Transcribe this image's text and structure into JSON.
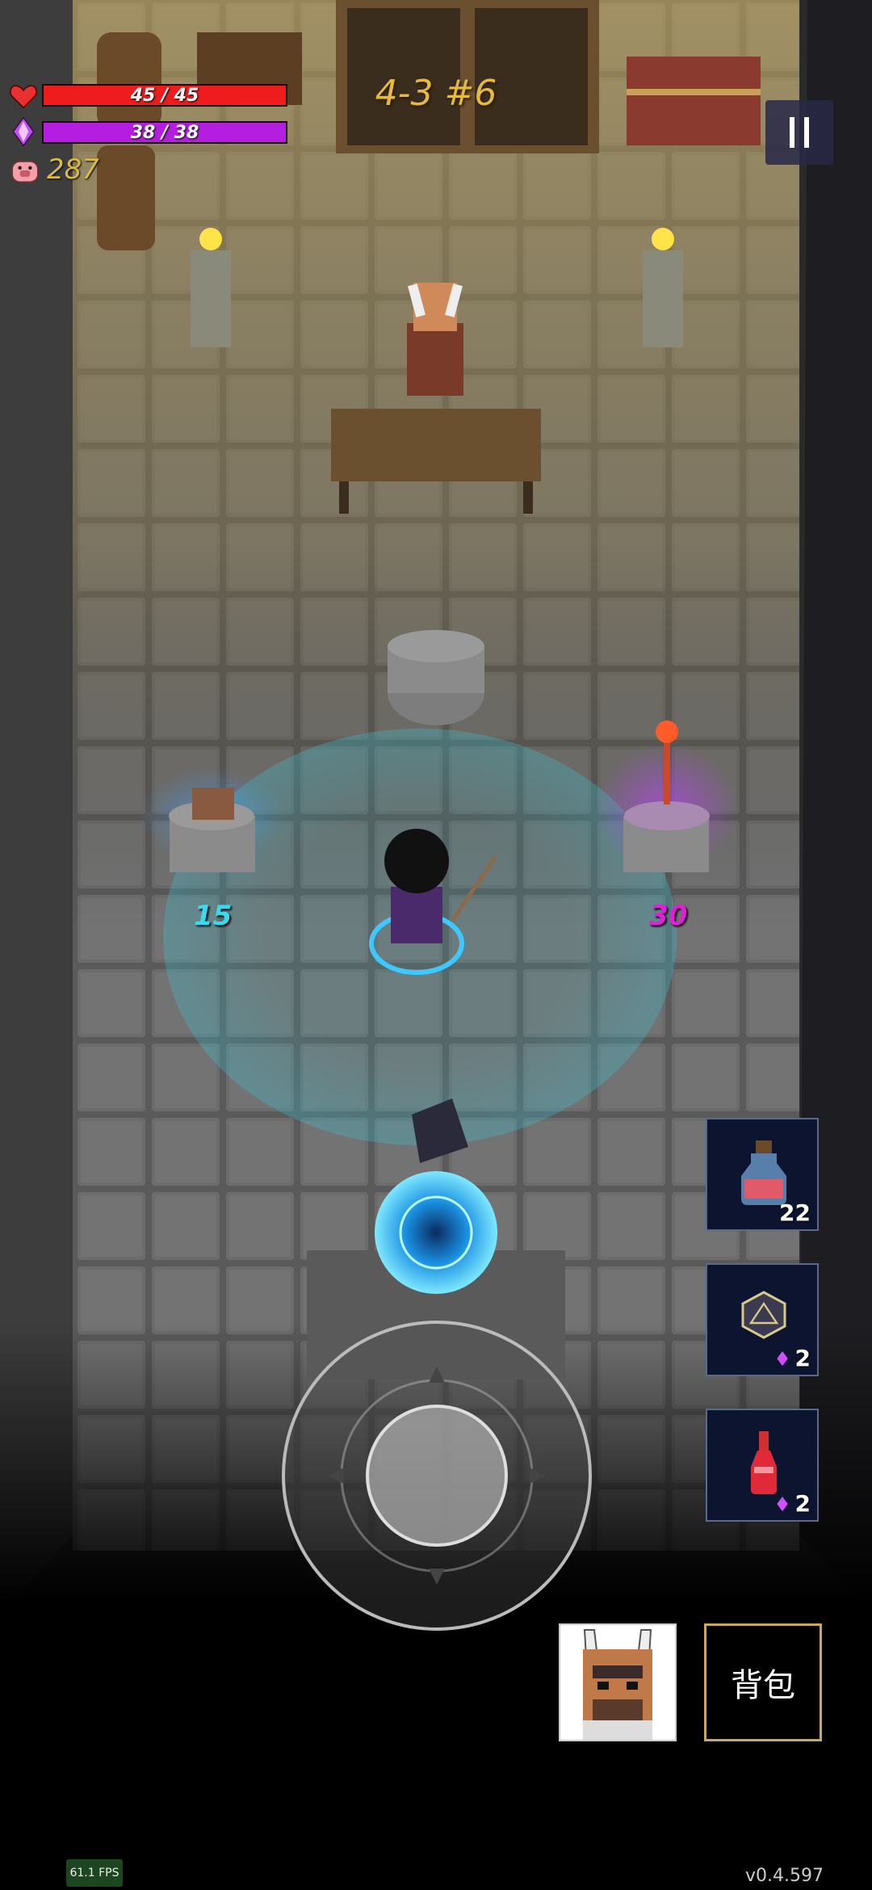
{
  "hud": {
    "hp": {
      "current": 45,
      "max": 45,
      "label": "45 / 45",
      "color": "#ee1c1c"
    },
    "mana": {
      "current": 38,
      "max": 38,
      "label": "38 / 38",
      "color": "#b51ee0"
    },
    "coins": "287",
    "level": "4-3 #6"
  },
  "world": {
    "shop_prices": {
      "left": "15",
      "right": "30"
    },
    "icons": [
      "heart-icon",
      "mana-crystal-icon",
      "pig-coin-icon",
      "pause-icon"
    ]
  },
  "quick_slots": [
    {
      "name": "blue-potion",
      "count": "22"
    },
    {
      "name": "d20-dice",
      "cost": "2"
    },
    {
      "name": "red-potion",
      "cost": "2"
    }
  ],
  "bottom": {
    "backpack_label": "背包",
    "fps": "61.1 FPS",
    "version": "v0.4.597"
  }
}
